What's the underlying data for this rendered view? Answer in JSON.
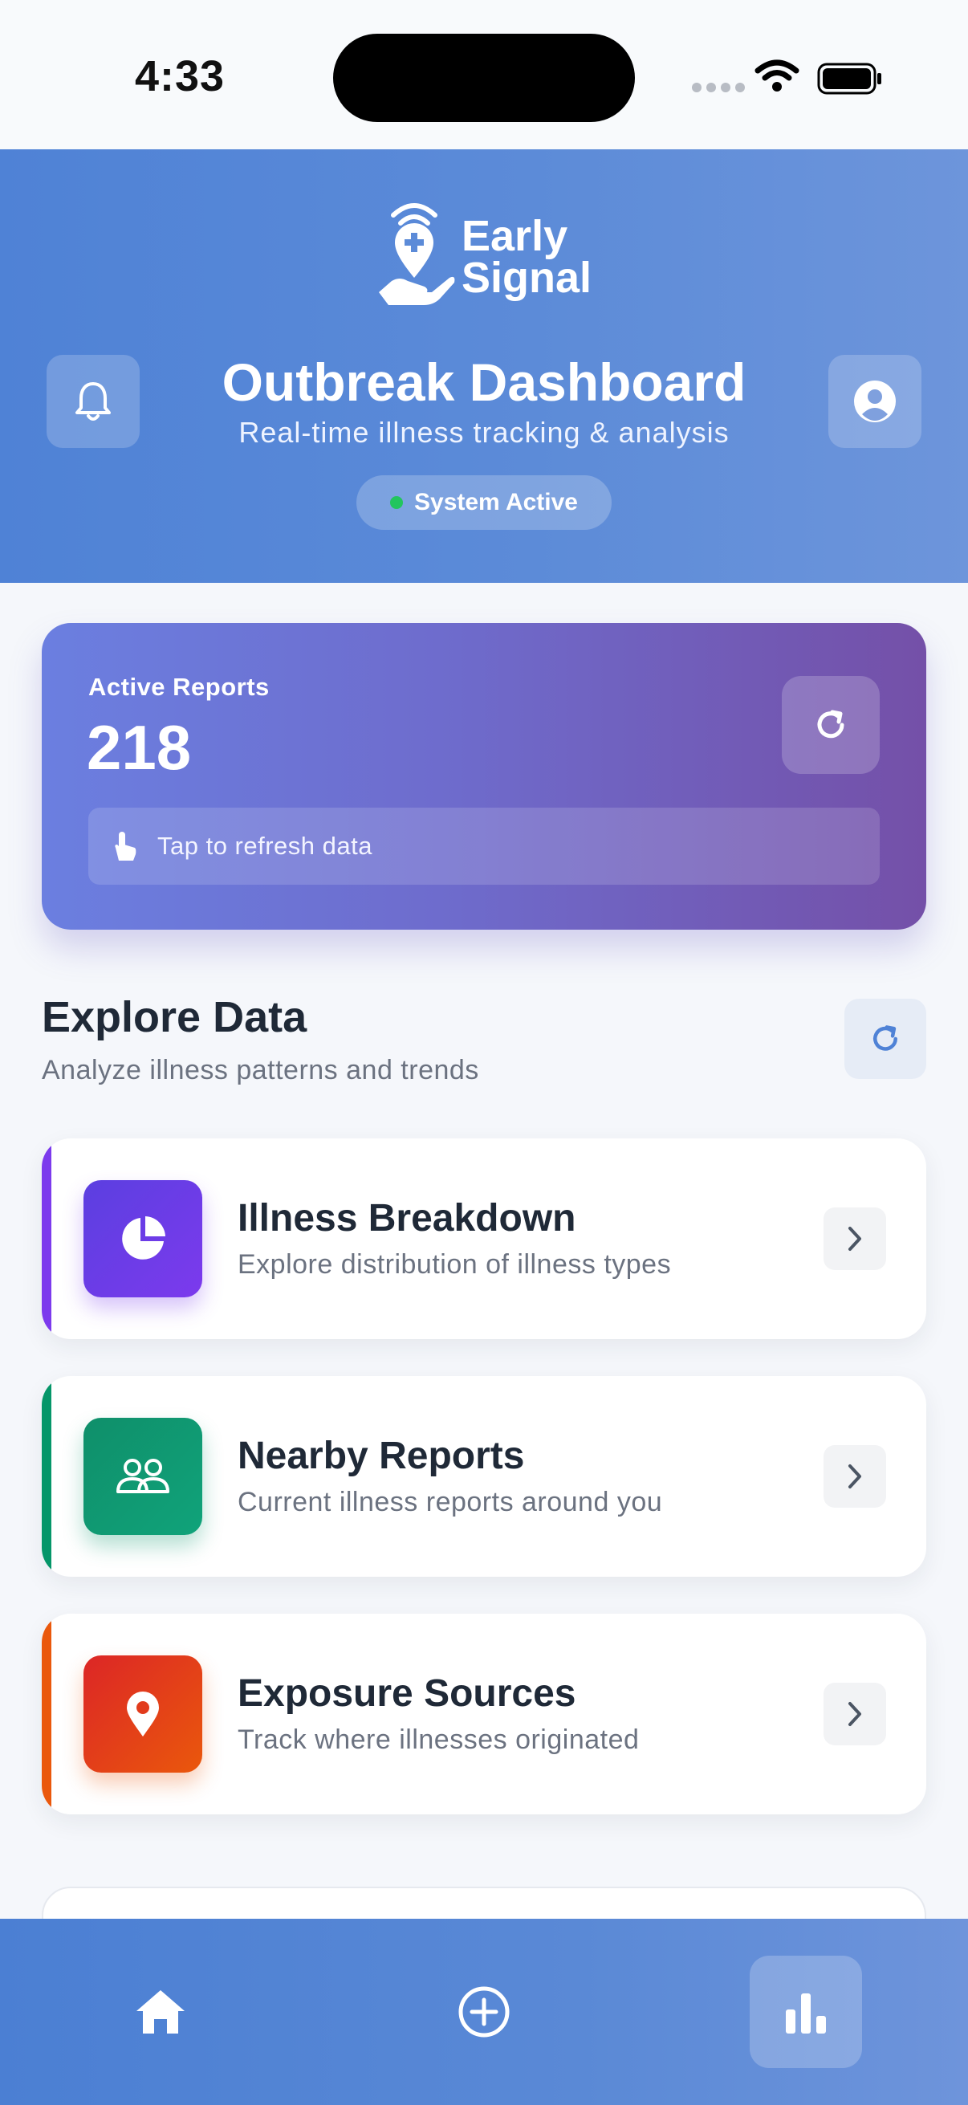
{
  "status_bar": {
    "time": "4:33"
  },
  "header": {
    "logo_line1": "Early",
    "logo_line2": "Signal",
    "title": "Outbreak Dashboard",
    "subtitle": "Real-time illness tracking & analysis",
    "status": "System Active",
    "status_color": "#22c55e"
  },
  "reports": {
    "label": "Active Reports",
    "count": "218",
    "tap_hint": "Tap to refresh data"
  },
  "explore": {
    "title": "Explore Data",
    "subtitle": "Analyze illness patterns and trends"
  },
  "cards": [
    {
      "title": "Illness Breakdown",
      "description": "Explore distribution of illness types",
      "icon": "pie-chart-icon",
      "accent": "#7c3aed"
    },
    {
      "title": "Nearby Reports",
      "description": "Current illness reports around you",
      "icon": "users-icon",
      "accent": "#059669"
    },
    {
      "title": "Exposure Sources",
      "description": "Track where illnesses originated",
      "icon": "location-pin-icon",
      "accent": "#ea580c"
    }
  ],
  "tab_bar": {
    "tabs": [
      {
        "icon": "home-icon"
      },
      {
        "icon": "add-circle-icon"
      },
      {
        "icon": "bar-chart-icon",
        "active": true
      }
    ]
  }
}
